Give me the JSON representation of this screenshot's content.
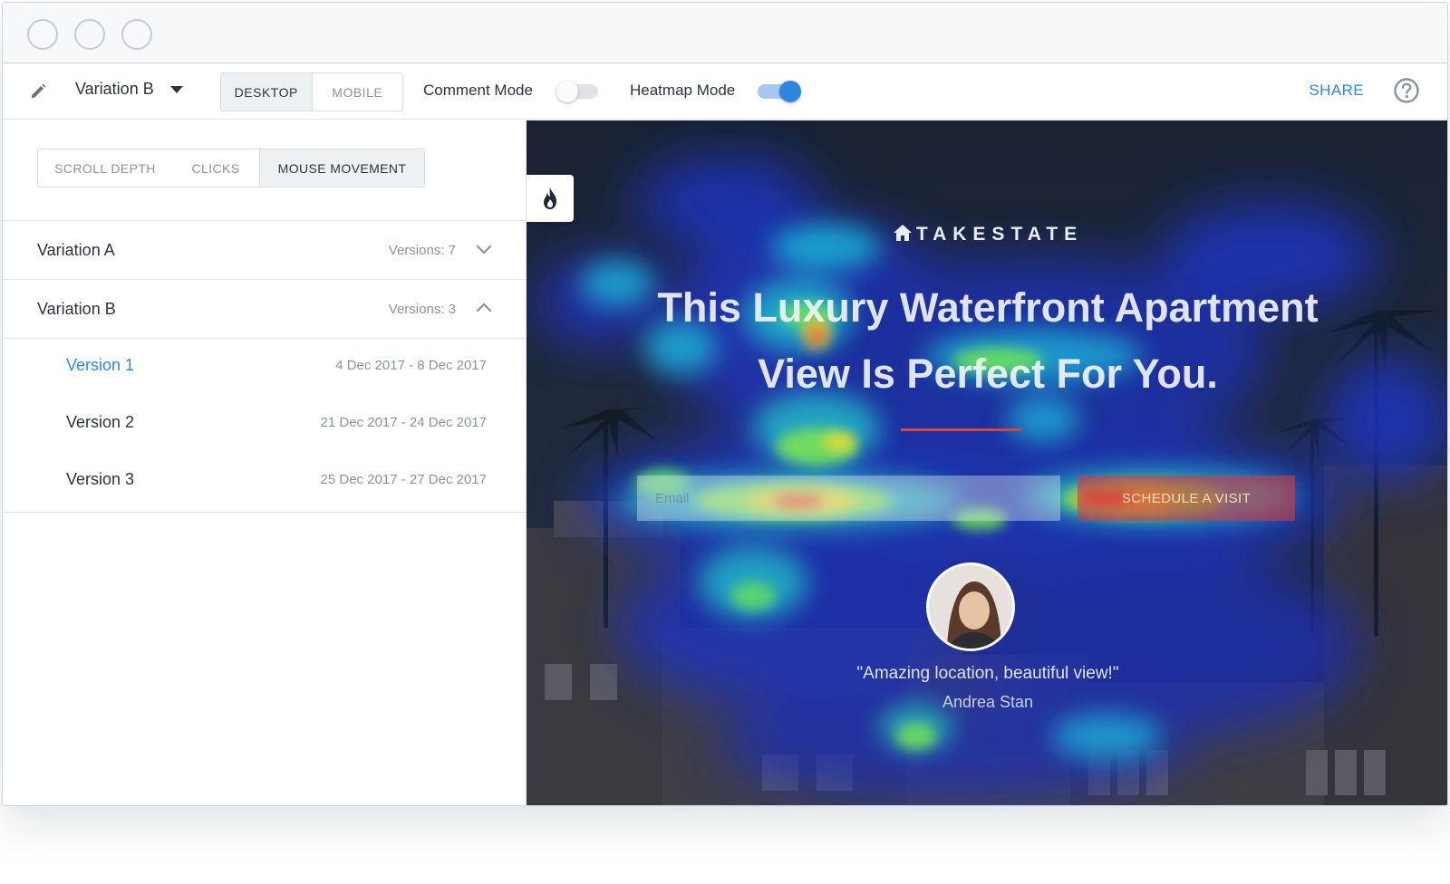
{
  "toolbar": {
    "variation_selected": "Variation B",
    "device_tabs": [
      "DESKTOP",
      "MOBILE"
    ],
    "comment_mode_label": "Comment Mode",
    "comment_mode_on": false,
    "heatmap_mode_label": "Heatmap Mode",
    "heatmap_mode_on": true,
    "share_label": "SHARE"
  },
  "sidebar": {
    "metric_tabs": [
      "SCROLL DEPTH",
      "CLICKS",
      "MOUSE MOVEMENT"
    ],
    "variations": [
      {
        "name": "Variation A",
        "versions_label": "Versions: 7",
        "expanded": false
      },
      {
        "name": "Variation B",
        "versions_label": "Versions: 3",
        "expanded": true
      }
    ],
    "versions": [
      {
        "name": "Version 1",
        "dates": "4 Dec 2017 - 8 Dec 2017",
        "active": true
      },
      {
        "name": "Version 2",
        "dates": "21 Dec 2017 - 24 Dec 2017",
        "active": false
      },
      {
        "name": "Version 3",
        "dates": "25 Dec 2017 - 27 Dec 2017",
        "active": false
      }
    ]
  },
  "preview": {
    "logo": "TAKESTATE",
    "headline_line1": "This Luxury Waterfront Apartment",
    "headline_line2": "View Is Perfect For You.",
    "email_placeholder": "Email",
    "cta_label": "SCHEDULE A VISIT",
    "quote": "\"Amazing location, beautiful view!\"",
    "author": "Andrea Stan"
  },
  "colors": {
    "accent": "#2f86de",
    "text": "#2b3440",
    "muted": "#8a939c",
    "cta": "#d8453d"
  },
  "icons": {
    "edit": "pencil-icon",
    "dropdown": "caret-down-icon",
    "help": "question-circle-icon",
    "heatmap": "flame-icon",
    "expand": "chevron-down-icon",
    "collapse": "chevron-up-icon"
  }
}
